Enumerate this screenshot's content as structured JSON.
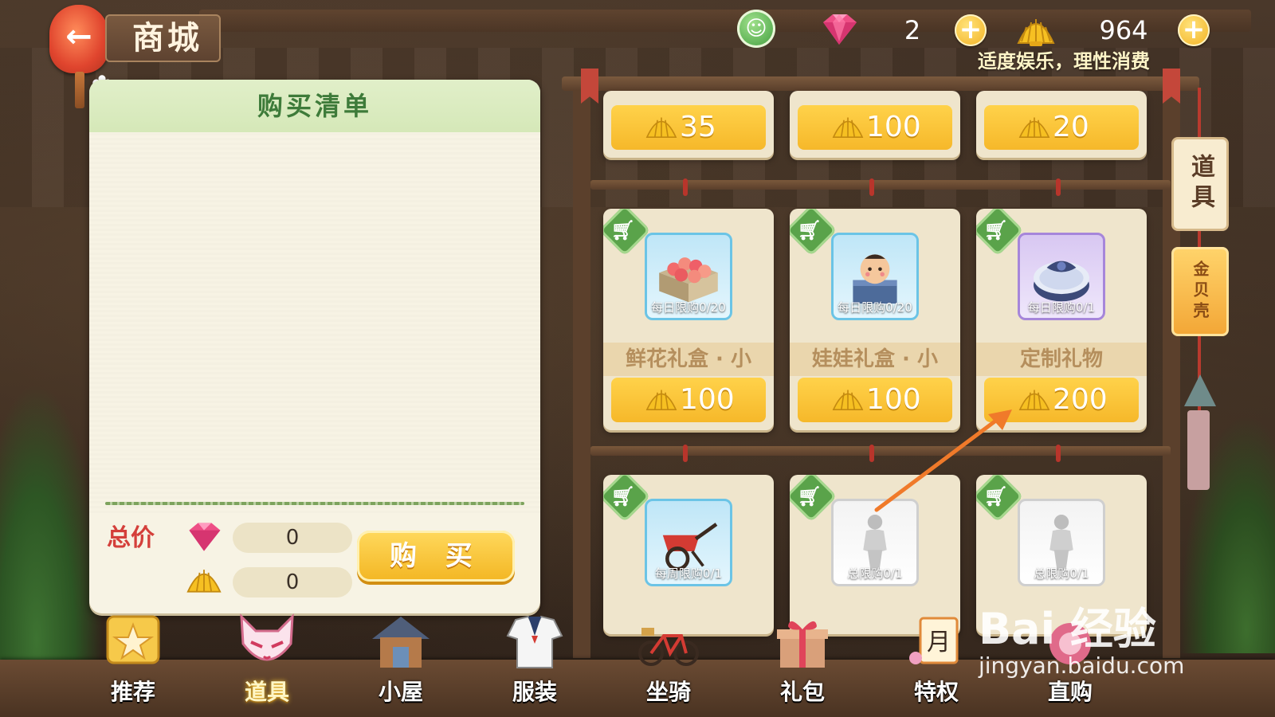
{
  "header": {
    "title": "商城",
    "gems": "2",
    "shells": "964",
    "notice": "适度娱乐，理性消费"
  },
  "cart": {
    "title": "购买清单",
    "total_label": "总价",
    "gem_total": "0",
    "shell_total": "0",
    "buy_label": "购 买"
  },
  "shop": {
    "top_row_prices": [
      "35",
      "100",
      "20"
    ],
    "row1": [
      {
        "limit": "每日限购0/20",
        "name": "鲜花礼盒 · 小",
        "price": "100",
        "icon": "flower-box-icon"
      },
      {
        "limit": "每日限购0/20",
        "name": "娃娃礼盒 · 小",
        "price": "100",
        "icon": "doll-box-icon"
      },
      {
        "limit": "每日限购0/1",
        "name": "定制礼物",
        "price": "200",
        "icon": "custom-gift-icon"
      }
    ],
    "row2": [
      {
        "limit": "每周限购0/1",
        "icon": "wheelbarrow-icon"
      },
      {
        "limit": "总限购0/1",
        "icon": "mannequin-icon"
      },
      {
        "limit": "总限购0/1",
        "icon": "mannequin-icon"
      }
    ]
  },
  "side_tabs": {
    "items": "道具",
    "shells": "金贝壳"
  },
  "nav": {
    "items": [
      {
        "label": "推荐",
        "icon": "star-icon"
      },
      {
        "label": "道具",
        "icon": "fox-mask-icon"
      },
      {
        "label": "小屋",
        "icon": "house-icon"
      },
      {
        "label": "服装",
        "icon": "sailor-uniform-icon"
      },
      {
        "label": "坐骑",
        "icon": "bicycle-icon"
      },
      {
        "label": "礼包",
        "icon": "gift-box-icon"
      },
      {
        "label": "特权",
        "icon": "month-card-icon"
      },
      {
        "label": "直购",
        "icon": "direct-buy-icon"
      }
    ],
    "active": "道具"
  },
  "watermark": {
    "logo": "Bai 经验",
    "url": "jingyan.baidu.com"
  },
  "colors": {
    "accent_gold": "#f6b82a",
    "panel_green": "#d5e8b8",
    "title_green": "#3e7b3a",
    "total_red": "#d43f3a",
    "wood": "#5b402c"
  }
}
